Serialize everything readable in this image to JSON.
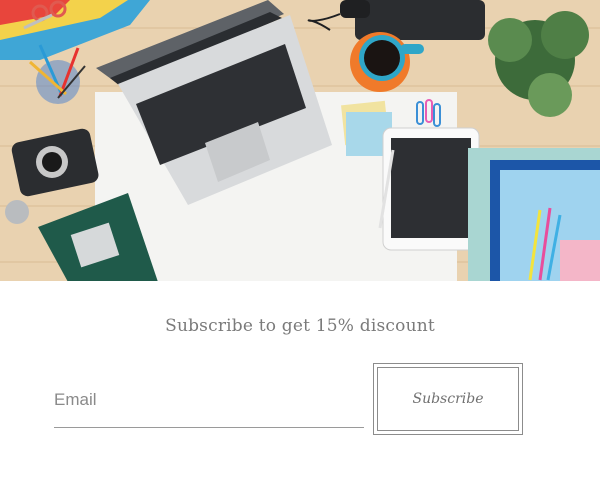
{
  "hero": {
    "image_description_icon": "desk-workspace-photo"
  },
  "newsletter": {
    "headline": "Subscribe to get 15% discount",
    "email_placeholder": "Email",
    "email_value": "",
    "subscribe_label": "Subscribe"
  },
  "colors": {
    "text": "#7a7a7a",
    "border": "#8c8c8c",
    "background": "#ffffff"
  }
}
